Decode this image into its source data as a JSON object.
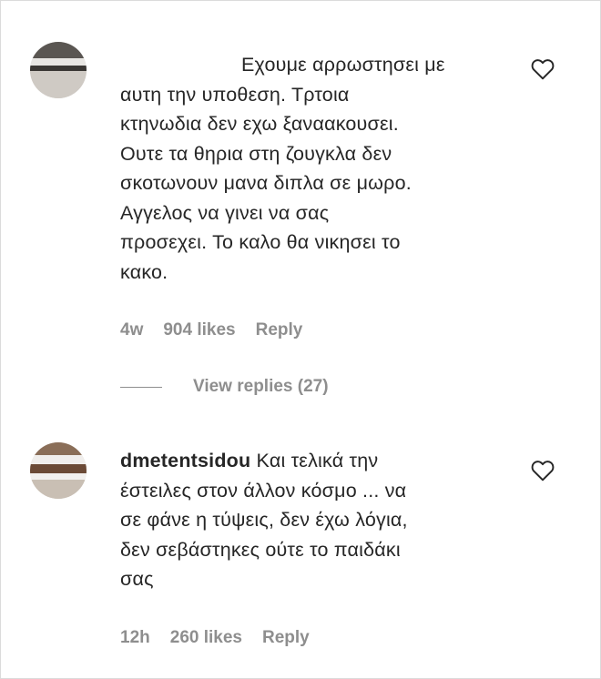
{
  "comments": [
    {
      "username": "",
      "text_lines": [
        "Εχουμε αρρωστησει με",
        "αυτη την υποθεση. Τρτοια",
        "κτηνωδια δεν εχω ξαναακουσει.",
        "Ουτε τα θηρια στη ζουγκλα δεν",
        "σκοτωνουν μανα διπλα σε μωρο.",
        "Αγγελος να γινει να σας",
        "προσεχει. Το καλο θα νικησει το",
        "κακο."
      ],
      "time": "4w",
      "likes": "904 likes",
      "reply_label": "Reply",
      "icons": {
        "like": "heart-outline-icon"
      },
      "view_replies": "View replies (27)"
    },
    {
      "username": "dmetentsidou",
      "text_first": "Και τελικά την",
      "text_lines": [
        "έστειλες στον άλλον κόσμο ... να",
        "σε φάνε η τύψεις, δεν έχω λόγια,",
        "δεν σεβάστηκες ούτε το παιδάκι",
        "σας"
      ],
      "time": "12h",
      "likes": "260 likes",
      "reply_label": "Reply",
      "icons": {
        "like": "heart-outline-icon"
      }
    }
  ],
  "colors": {
    "text": "#262626",
    "muted": "#8e8e8e",
    "border": "#dbdbdb"
  }
}
